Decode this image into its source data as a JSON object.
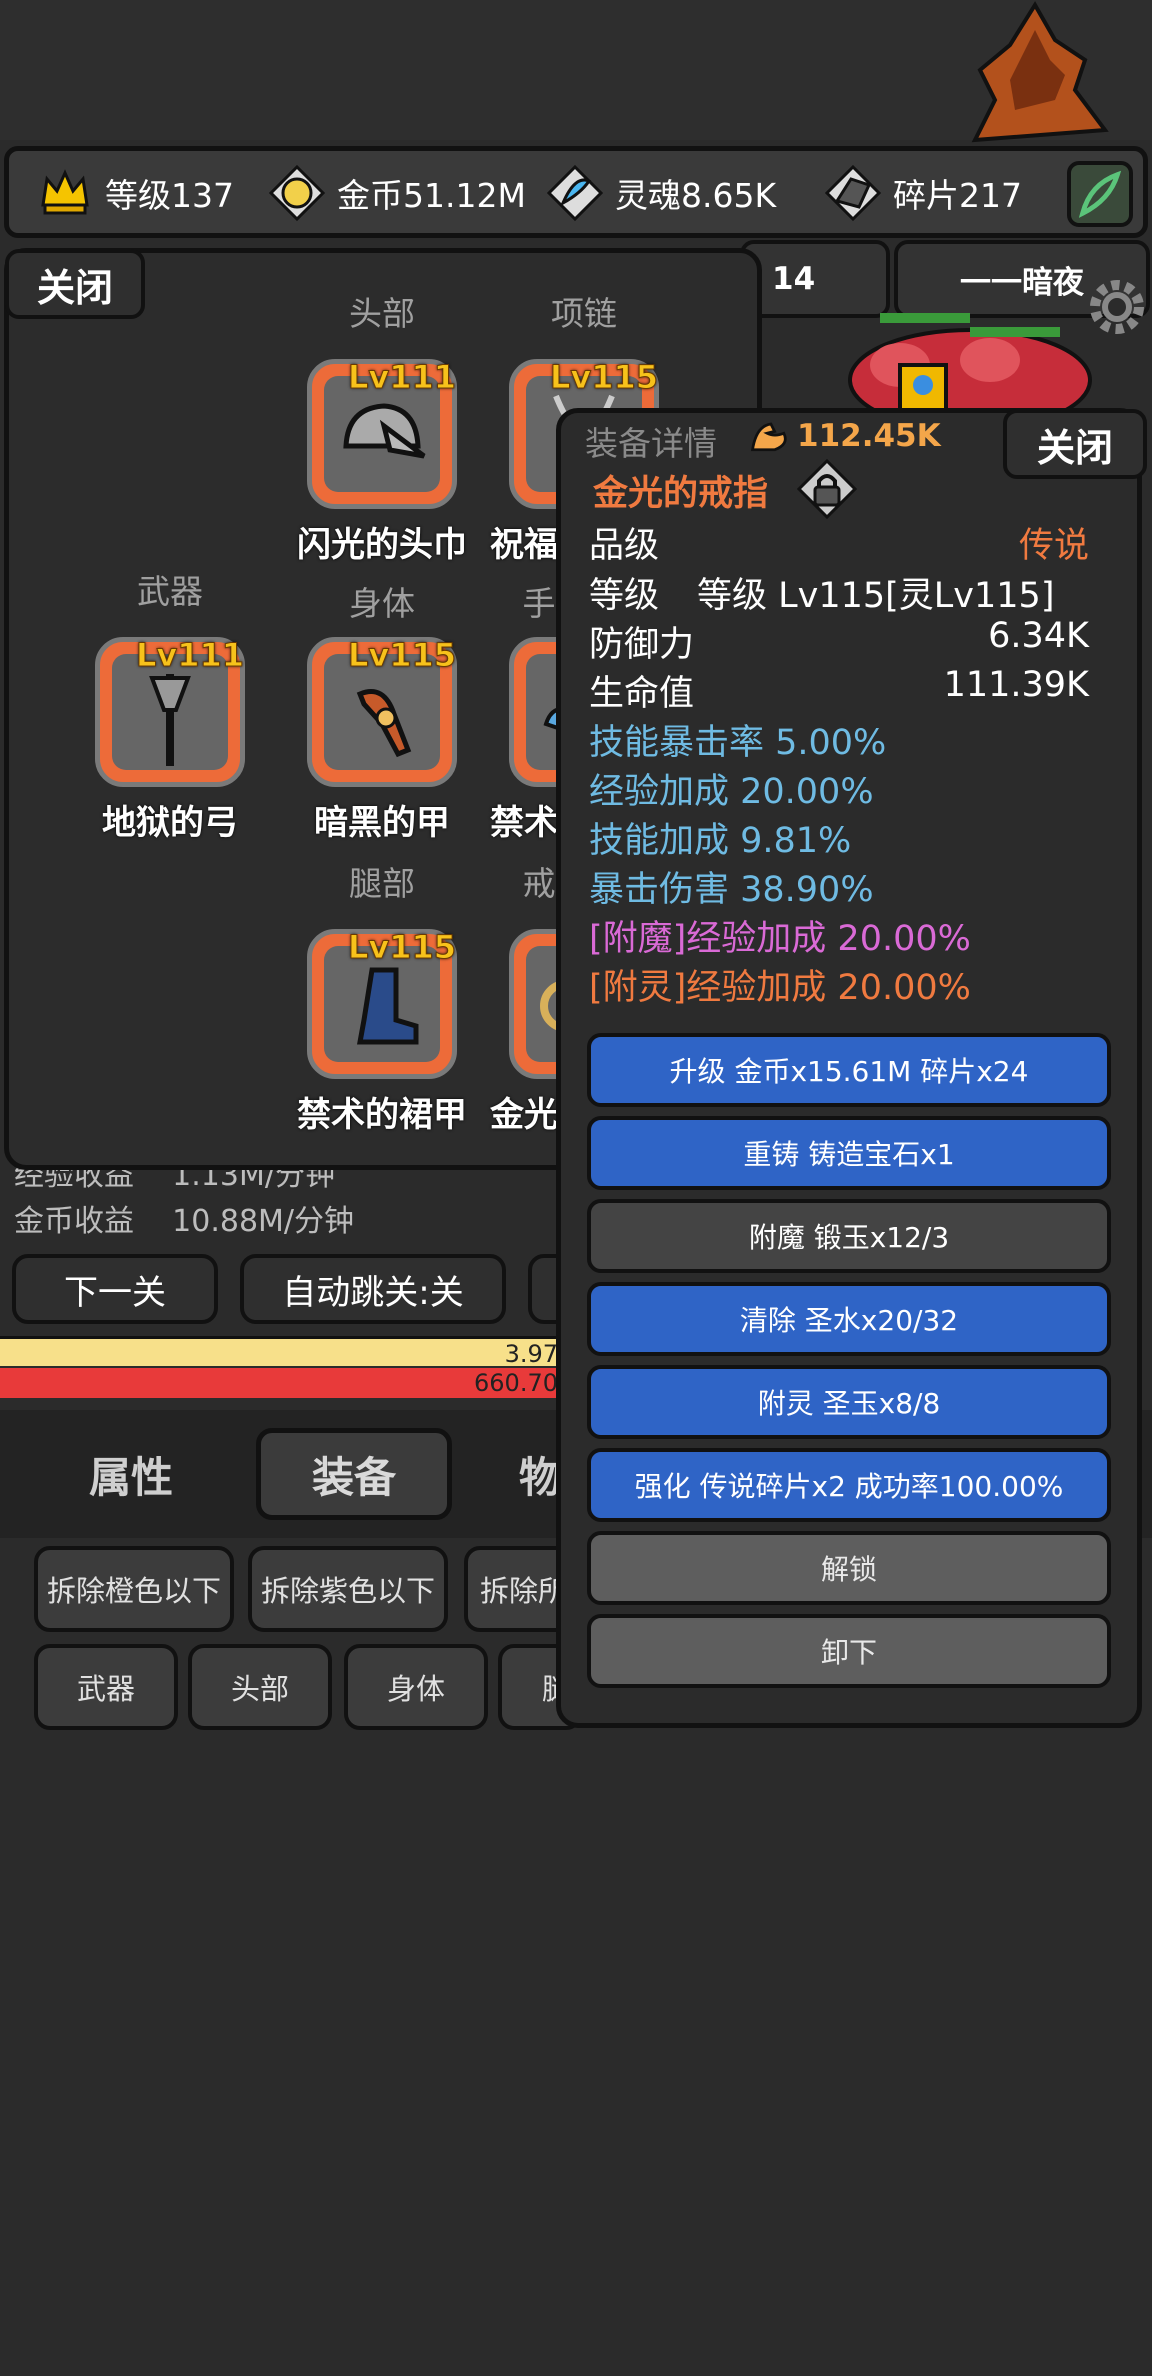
{
  "resources": {
    "level": "等级137",
    "gold": "金币51.12M",
    "soul": "灵魂8.65K",
    "shards": "碎片217"
  },
  "background": {
    "stage_number": "14",
    "stage_name": "一一暗夜",
    "exp_income_label": "经验收益",
    "exp_income_value": "1.13M/分钟",
    "gold_income_label": "金币收益",
    "gold_income_value": "10.88M/分钟",
    "next_stage": "下一关",
    "auto_jump": "自动跳关:关",
    "bar1_value": "3.97",
    "bar2_value": "660.70"
  },
  "tabs": [
    "属性",
    "装备",
    "物"
  ],
  "filters_row1": [
    "拆除橙色以下",
    "拆除紫色以下",
    "拆除所"
  ],
  "filters_row2": [
    "武器",
    "头部",
    "身体",
    "腿"
  ],
  "equip_panel": {
    "close": "关闭",
    "slots": [
      {
        "label": "头部",
        "level": "Lv111",
        "name": "闪光的头巾",
        "icon": "helmet-icon"
      },
      {
        "label": "项链",
        "level": "Lv115",
        "name": "祝福",
        "icon": "necklace-icon"
      },
      {
        "label": "武器",
        "level": "Lv111",
        "name": "地狱的弓",
        "icon": "weapon-icon"
      },
      {
        "label": "身体",
        "level": "Lv115",
        "name": "暗黑的甲",
        "icon": "armor-icon"
      },
      {
        "label": "手",
        "level": "",
        "name": "禁术",
        "icon": "glove-icon"
      },
      {
        "label": "腿部",
        "level": "Lv115",
        "name": "禁术的裙甲",
        "icon": "boot-icon"
      },
      {
        "label": "戒",
        "level": "",
        "name": "金光",
        "icon": "ring-icon"
      }
    ]
  },
  "detail": {
    "header": "装备详情",
    "power": "112.45K",
    "close": "关闭",
    "item_name": "金光的戒指",
    "quality_label": "品级",
    "quality_value": "传说",
    "level_label": "等级",
    "level_value": "等级 Lv115[灵Lv115]",
    "defense_label": "防御力",
    "defense_value": "6.34K",
    "hp_label": "生命值",
    "hp_value": "111.39K",
    "bonuses": [
      "技能暴击率 5.00%",
      "经验加成 20.00%",
      "技能加成 9.81%",
      "暴击伤害 38.90%"
    ],
    "enchant": "[附魔]经验加成 20.00%",
    "spirit": "[附灵]经验加成 20.00%",
    "actions": [
      "升级 金币x15.61M 碎片x24",
      "重铸 铸造宝石x1",
      "附魔 锻玉x12/3",
      "清除 圣水x20/32",
      "附灵 圣玉x8/8",
      "强化 传说碎片x2 成功率100.00%",
      "解锁",
      "卸下"
    ]
  },
  "colors": {
    "legendary": "#f07a40",
    "bonus": "#6fbbe3",
    "enchant": "#da6ad6",
    "action_blue": "#2f64c6",
    "slot_orange": "#ed6b39",
    "level_gold": "#f7c21b"
  }
}
